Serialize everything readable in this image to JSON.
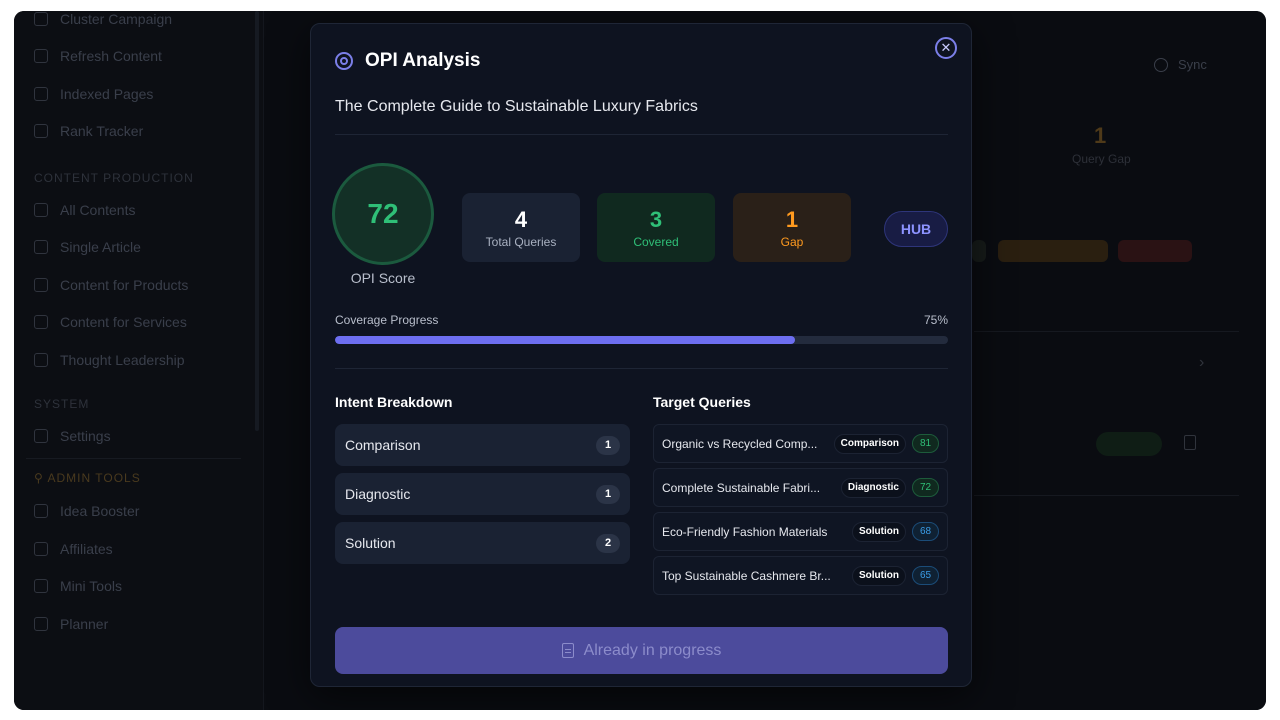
{
  "sidebar": {
    "items_top": [
      {
        "label": "Cluster Campaign",
        "icon": "person-icon"
      },
      {
        "label": "Refresh Content",
        "icon": "refresh-icon"
      },
      {
        "label": "Indexed Pages",
        "icon": "database-icon"
      },
      {
        "label": "Rank Tracker",
        "icon": "bar-chart-icon"
      }
    ],
    "section_content": "CONTENT PRODUCTION",
    "items_content": [
      {
        "label": "All Contents",
        "icon": "folder-icon"
      },
      {
        "label": "Single Article",
        "icon": "tag-icon"
      },
      {
        "label": "Content for Products",
        "icon": "folder-icon"
      },
      {
        "label": "Content for Services",
        "icon": "sparkle-icon"
      },
      {
        "label": "Thought Leadership",
        "icon": "chat-icon"
      }
    ],
    "section_system": "SYSTEM",
    "items_system": [
      {
        "label": "Settings",
        "icon": "gear-icon"
      }
    ],
    "section_admin": "ADMIN TOOLS",
    "items_admin": [
      {
        "label": "Idea Booster",
        "icon": "bolt-icon"
      },
      {
        "label": "Affiliates",
        "icon": "users-icon"
      },
      {
        "label": "Mini Tools",
        "icon": "wrench-icon"
      },
      {
        "label": "Planner",
        "icon": "calendar-icon"
      }
    ]
  },
  "background": {
    "sync_label": "Sync",
    "query_gap_value": "1",
    "query_gap_label": "Query Gap"
  },
  "modal": {
    "title": "OPI Analysis",
    "subtitle": "The Complete Guide to Sustainable Luxury Fabrics",
    "close_symbol": "✕",
    "score": {
      "value": "72",
      "label": "OPI Score"
    },
    "stats": {
      "total": {
        "value": "4",
        "label": "Total Queries"
      },
      "covered": {
        "value": "3",
        "label": "Covered"
      },
      "gap": {
        "value": "1",
        "label": "Gap"
      }
    },
    "hub_label": "HUB",
    "progress": {
      "label": "Coverage Progress",
      "percent_text": "75%",
      "value": 0.75
    },
    "intent": {
      "title": "Intent Breakdown",
      "items": [
        {
          "name": "Comparison",
          "count": "1"
        },
        {
          "name": "Diagnostic",
          "count": "1"
        },
        {
          "name": "Solution",
          "count": "2"
        }
      ]
    },
    "queries": {
      "title": "Target Queries",
      "items": [
        {
          "text": "Organic vs Recycled Comp...",
          "tag": "Comparison",
          "score": "81",
          "color": "green"
        },
        {
          "text": "Complete Sustainable Fabri...",
          "tag": "Diagnostic",
          "score": "72",
          "color": "green"
        },
        {
          "text": "Eco-Friendly Fashion Materials",
          "tag": "Solution",
          "score": "68",
          "color": "blue"
        },
        {
          "text": "Top Sustainable Cashmere Br...",
          "tag": "Solution",
          "score": "65",
          "color": "blue"
        }
      ]
    },
    "action_label": "Already in progress",
    "colors": {
      "accent": "#6d6ef0",
      "covered": "#2fbf77",
      "gap": "#ff9a1f"
    }
  }
}
